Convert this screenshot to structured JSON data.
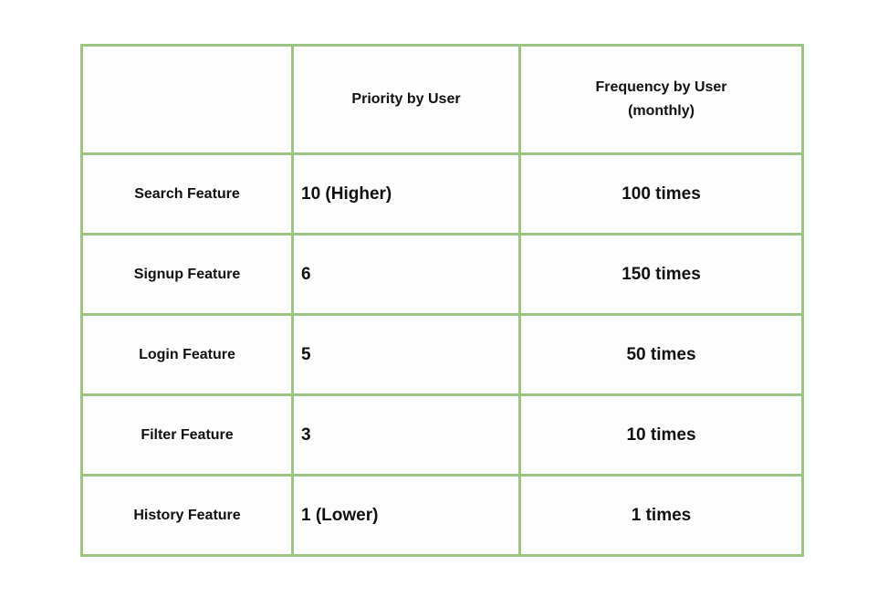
{
  "table": {
    "headers": [
      "",
      "Priority by User",
      "Frequency by User",
      "(monthly)"
    ],
    "rows": [
      {
        "feature": "Search Feature",
        "priority": "10 (Higher)",
        "frequency": "100 times"
      },
      {
        "feature": "Signup Feature",
        "priority": "6",
        "frequency": "150 times"
      },
      {
        "feature": "Login Feature",
        "priority": "5",
        "frequency": "50 times"
      },
      {
        "feature": "Filter Feature",
        "priority": "3",
        "frequency": "10 times"
      },
      {
        "feature": "History Feature",
        "priority": "1 (Lower)",
        "frequency": "1 times"
      }
    ],
    "border_color": "#9cc584"
  }
}
